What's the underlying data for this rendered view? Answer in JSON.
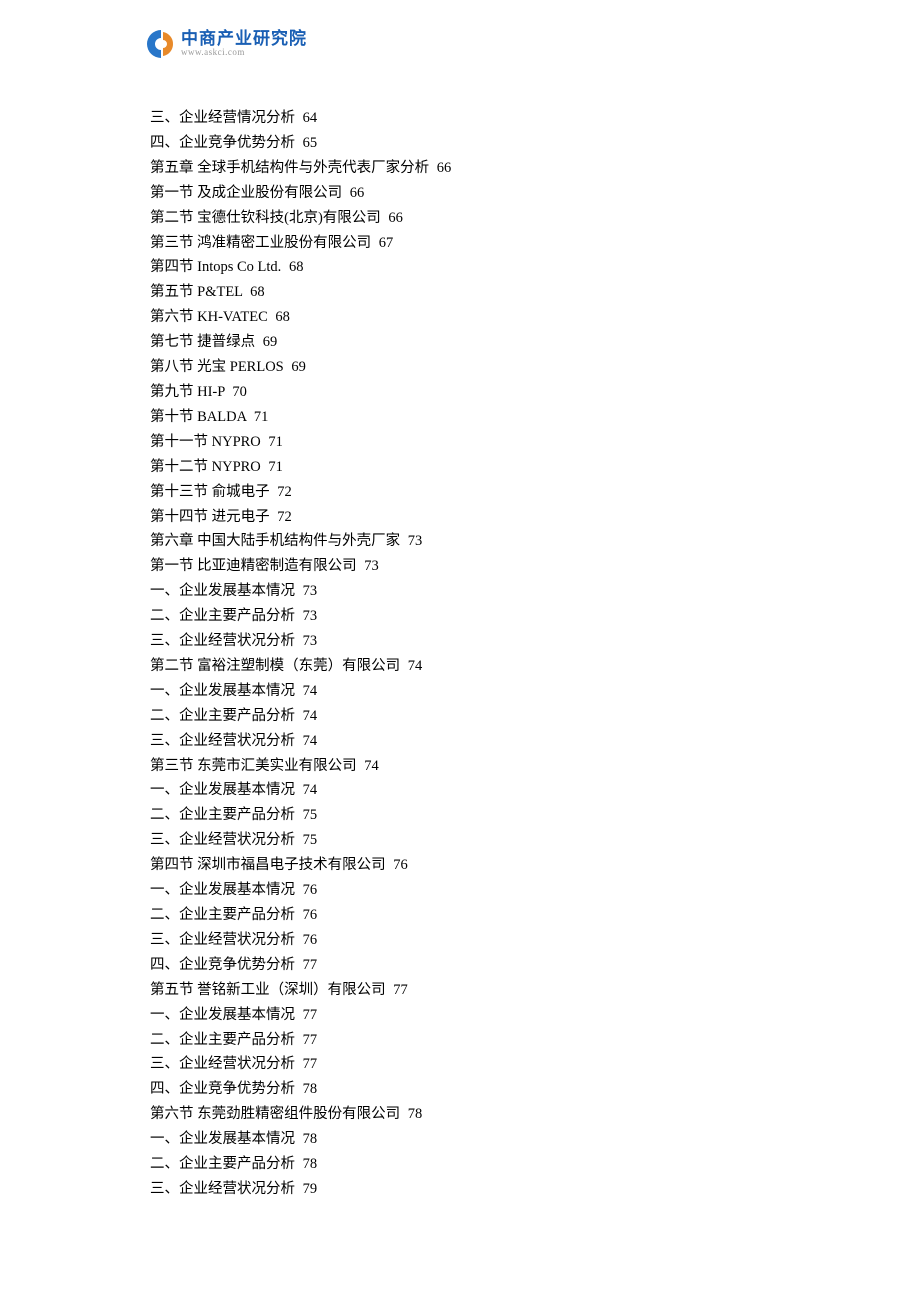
{
  "logo": {
    "cn": "中商产业研究院",
    "en": "www.askci.com"
  },
  "toc": [
    {
      "title": "三、企业经营情况分析",
      "page": "64"
    },
    {
      "title": "四、企业竞争优势分析",
      "page": "65"
    },
    {
      "title": "第五章 全球手机结构件与外壳代表厂家分析",
      "page": "66"
    },
    {
      "title": "第一节 及成企业股份有限公司",
      "page": "66"
    },
    {
      "title": "第二节 宝德仕钦科技(北京)有限公司",
      "page": "66"
    },
    {
      "title": "第三节 鸿准精密工业股份有限公司",
      "page": "67"
    },
    {
      "title": "第四节 Intops Co Ltd.",
      "page": "68"
    },
    {
      "title": "第五节 P&TEL",
      "page": "68"
    },
    {
      "title": "第六节 KH-VATEC",
      "page": "68"
    },
    {
      "title": "第七节 捷普绿点",
      "page": "69"
    },
    {
      "title": "第八节 光宝 PERLOS",
      "page": "69"
    },
    {
      "title": "第九节 HI-P",
      "page": "70"
    },
    {
      "title": "第十节 BALDA",
      "page": "71"
    },
    {
      "title": "第十一节 NYPRO",
      "page": "71"
    },
    {
      "title": "第十二节 NYPRO",
      "page": "71"
    },
    {
      "title": "第十三节 俞城电子",
      "page": "72"
    },
    {
      "title": "第十四节 进元电子",
      "page": "72"
    },
    {
      "title": "第六章 中国大陆手机结构件与外壳厂家",
      "page": "73"
    },
    {
      "title": "第一节 比亚迪精密制造有限公司",
      "page": "73"
    },
    {
      "title": "一、企业发展基本情况",
      "page": "73"
    },
    {
      "title": "二、企业主要产品分析",
      "page": "73"
    },
    {
      "title": "三、企业经营状况分析",
      "page": "73"
    },
    {
      "title": "第二节 富裕注塑制模（东莞）有限公司",
      "page": "74"
    },
    {
      "title": "一、企业发展基本情况",
      "page": "74"
    },
    {
      "title": "二、企业主要产品分析",
      "page": "74"
    },
    {
      "title": "三、企业经营状况分析",
      "page": "74"
    },
    {
      "title": "第三节 东莞市汇美实业有限公司",
      "page": "74"
    },
    {
      "title": "一、企业发展基本情况",
      "page": "74"
    },
    {
      "title": "二、企业主要产品分析",
      "page": "75"
    },
    {
      "title": "三、企业经营状况分析",
      "page": "75"
    },
    {
      "title": "第四节 深圳市福昌电子技术有限公司",
      "page": "76"
    },
    {
      "title": "一、企业发展基本情况",
      "page": "76"
    },
    {
      "title": "二、企业主要产品分析",
      "page": "76"
    },
    {
      "title": "三、企业经营状况分析",
      "page": "76"
    },
    {
      "title": "四、企业竞争优势分析",
      "page": "77"
    },
    {
      "title": "第五节 誉铭新工业（深圳）有限公司",
      "page": "77"
    },
    {
      "title": "一、企业发展基本情况",
      "page": "77"
    },
    {
      "title": "二、企业主要产品分析",
      "page": "77"
    },
    {
      "title": "三、企业经营状况分析",
      "page": "77"
    },
    {
      "title": "四、企业竞争优势分析",
      "page": "78"
    },
    {
      "title": "第六节 东莞劲胜精密组件股份有限公司",
      "page": "78"
    },
    {
      "title": "一、企业发展基本情况",
      "page": "78"
    },
    {
      "title": "二、企业主要产品分析",
      "page": "78"
    },
    {
      "title": "三、企业经营状况分析",
      "page": "79"
    }
  ]
}
